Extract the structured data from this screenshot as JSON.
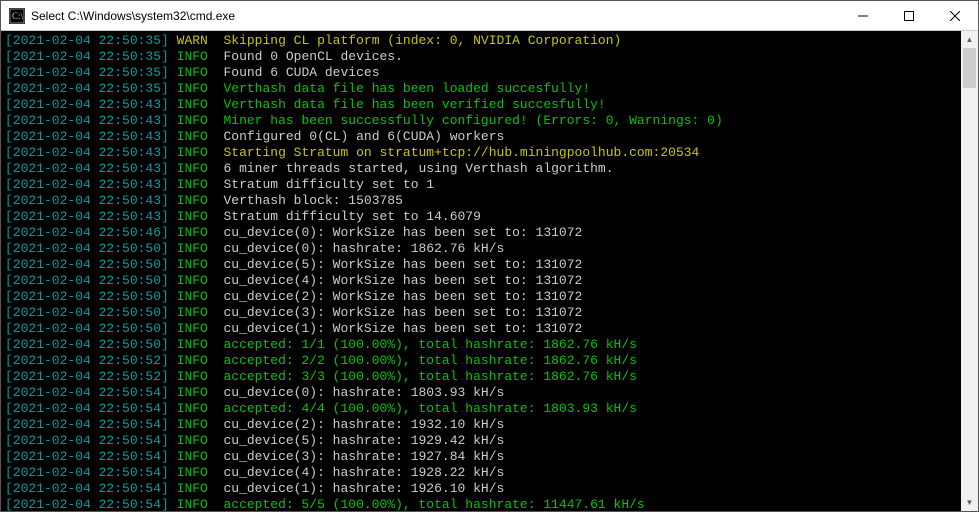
{
  "window": {
    "title": "Select C:\\Windows\\system32\\cmd.exe"
  },
  "log": [
    {
      "ts": "[2021-02-04 22:50:35]",
      "level": "WARN",
      "msg": "Skipping CL platform (index: 0, NVIDIA Corporation)",
      "style": "y"
    },
    {
      "ts": "[2021-02-04 22:50:35]",
      "level": "INFO",
      "msg": "Found 0 OpenCL devices.",
      "style": "w"
    },
    {
      "ts": "[2021-02-04 22:50:35]",
      "level": "INFO",
      "msg": "Found 6 CUDA devices",
      "style": "w"
    },
    {
      "ts": "[2021-02-04 22:50:35]",
      "level": "INFO",
      "msg": "Verthash data file has been loaded succesfully!",
      "style": "g"
    },
    {
      "ts": "[2021-02-04 22:50:43]",
      "level": "INFO",
      "msg": "Verthash data file has been verified succesfully!",
      "style": "g"
    },
    {
      "ts": "[2021-02-04 22:50:43]",
      "level": "INFO",
      "msg": "Miner has been successfully configured! (Errors: 0, Warnings: 0)",
      "style": "g"
    },
    {
      "ts": "[2021-02-04 22:50:43]",
      "level": "INFO",
      "msg": "Configured 0(CL) and 6(CUDA) workers",
      "style": "w"
    },
    {
      "ts": "[2021-02-04 22:50:43]",
      "level": "INFO",
      "msg": "Starting Stratum on stratum+tcp://hub.miningpoolhub.com:20534",
      "style": "y"
    },
    {
      "ts": "[2021-02-04 22:50:43]",
      "level": "INFO",
      "msg": "6 miner threads started, using Verthash algorithm.",
      "style": "w"
    },
    {
      "ts": "[2021-02-04 22:50:43]",
      "level": "INFO",
      "msg": "Stratum difficulty set to 1",
      "style": "w"
    },
    {
      "ts": "[2021-02-04 22:50:43]",
      "level": "INFO",
      "msg": "Verthash block: 1503785",
      "style": "w"
    },
    {
      "ts": "[2021-02-04 22:50:43]",
      "level": "INFO",
      "msg": "Stratum difficulty set to 14.6079",
      "style": "w"
    },
    {
      "ts": "[2021-02-04 22:50:46]",
      "level": "INFO",
      "msg": "cu_device(0): WorkSize has been set to: 131072",
      "style": "w"
    },
    {
      "ts": "[2021-02-04 22:50:50]",
      "level": "INFO",
      "msg": "cu_device(0): hashrate: 1862.76 kH/s",
      "style": "w"
    },
    {
      "ts": "[2021-02-04 22:50:50]",
      "level": "INFO",
      "msg": "cu_device(5): WorkSize has been set to: 131072",
      "style": "w"
    },
    {
      "ts": "[2021-02-04 22:50:50]",
      "level": "INFO",
      "msg": "cu_device(4): WorkSize has been set to: 131072",
      "style": "w"
    },
    {
      "ts": "[2021-02-04 22:50:50]",
      "level": "INFO",
      "msg": "cu_device(2): WorkSize has been set to: 131072",
      "style": "w"
    },
    {
      "ts": "[2021-02-04 22:50:50]",
      "level": "INFO",
      "msg": "cu_device(3): WorkSize has been set to: 131072",
      "style": "w"
    },
    {
      "ts": "[2021-02-04 22:50:50]",
      "level": "INFO",
      "msg": "cu_device(1): WorkSize has been set to: 131072",
      "style": "w"
    },
    {
      "ts": "[2021-02-04 22:50:50]",
      "level": "INFO",
      "msg": "accepted: 1/1 (100.00%), total hashrate: 1862.76 kH/s",
      "style": "g"
    },
    {
      "ts": "[2021-02-04 22:50:52]",
      "level": "INFO",
      "msg": "accepted: 2/2 (100.00%), total hashrate: 1862.76 kH/s",
      "style": "g"
    },
    {
      "ts": "[2021-02-04 22:50:52]",
      "level": "INFO",
      "msg": "accepted: 3/3 (100.00%), total hashrate: 1862.76 kH/s",
      "style": "g"
    },
    {
      "ts": "[2021-02-04 22:50:54]",
      "level": "INFO",
      "msg": "cu_device(0): hashrate: 1803.93 kH/s",
      "style": "w"
    },
    {
      "ts": "[2021-02-04 22:50:54]",
      "level": "INFO",
      "msg": "accepted: 4/4 (100.00%), total hashrate: 1803.93 kH/s",
      "style": "g"
    },
    {
      "ts": "[2021-02-04 22:50:54]",
      "level": "INFO",
      "msg": "cu_device(2): hashrate: 1932.10 kH/s",
      "style": "w"
    },
    {
      "ts": "[2021-02-04 22:50:54]",
      "level": "INFO",
      "msg": "cu_device(5): hashrate: 1929.42 kH/s",
      "style": "w"
    },
    {
      "ts": "[2021-02-04 22:50:54]",
      "level": "INFO",
      "msg": "cu_device(3): hashrate: 1927.84 kH/s",
      "style": "w"
    },
    {
      "ts": "[2021-02-04 22:50:54]",
      "level": "INFO",
      "msg": "cu_device(4): hashrate: 1928.22 kH/s",
      "style": "w"
    },
    {
      "ts": "[2021-02-04 22:50:54]",
      "level": "INFO",
      "msg": "cu_device(1): hashrate: 1926.10 kH/s",
      "style": "w"
    },
    {
      "ts": "[2021-02-04 22:50:54]",
      "level": "INFO",
      "msg": "accepted: 5/5 (100.00%), total hashrate: 11447.61 kH/s",
      "style": "g"
    }
  ]
}
